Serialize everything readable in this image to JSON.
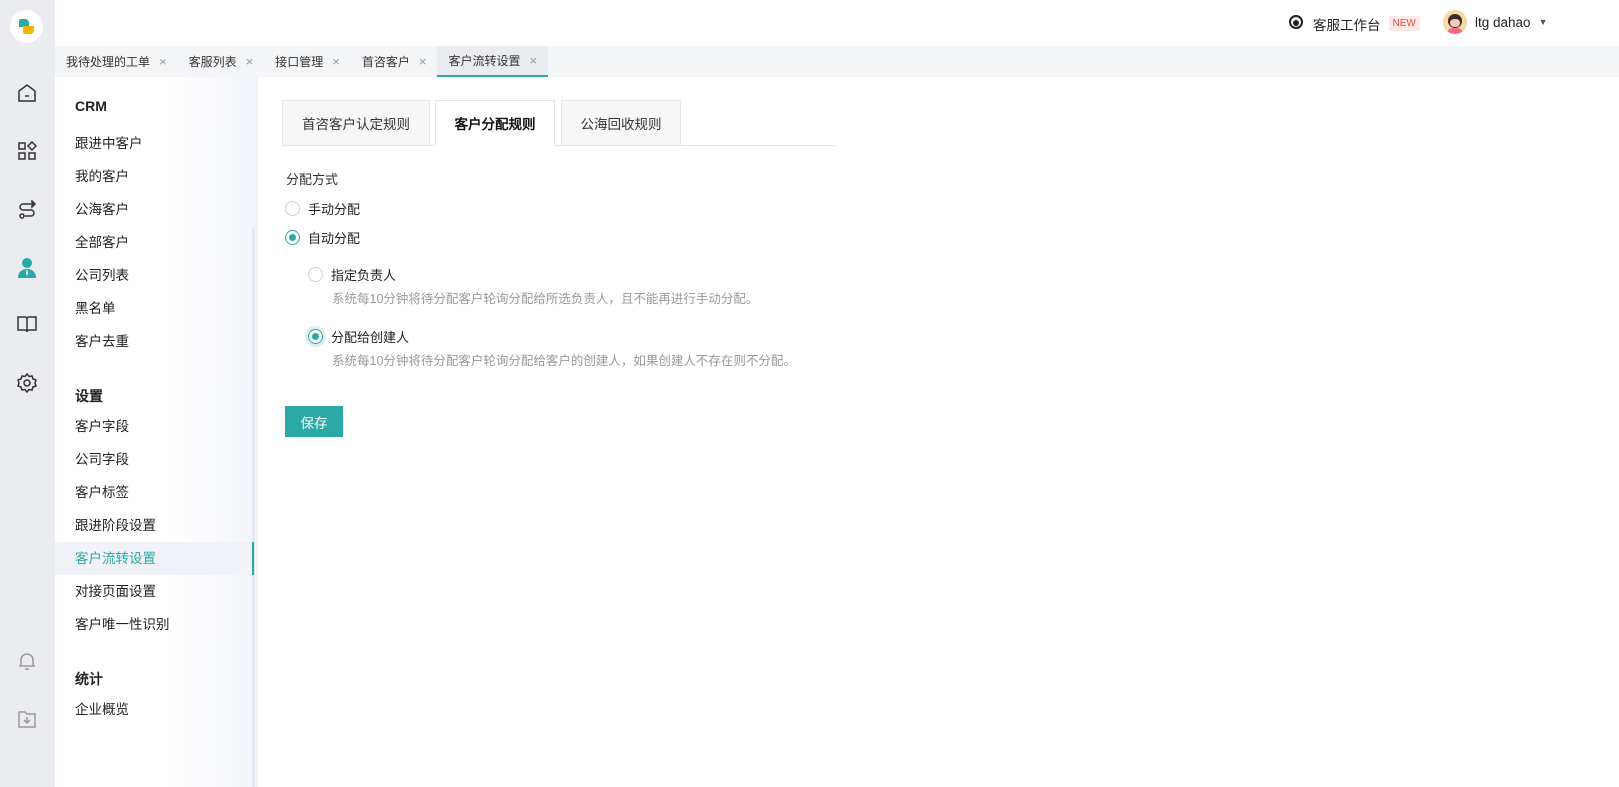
{
  "topbar": {
    "workbench": "客服工作台",
    "badge": "NEW",
    "user": "ltg dahao"
  },
  "tabs": [
    {
      "label": "我待处理的工单"
    },
    {
      "label": "客服列表"
    },
    {
      "label": "接口管理"
    },
    {
      "label": "首咨客户"
    },
    {
      "label": "客户流转设置"
    }
  ],
  "tab_close": "×",
  "sidebar": {
    "sections": [
      {
        "title": "CRM",
        "items": [
          "跟进中客户",
          "我的客户",
          "公海客户",
          "全部客户",
          "公司列表",
          "黑名单",
          "客户去重"
        ]
      },
      {
        "title": "设置",
        "items": [
          "客户字段",
          "公司字段",
          "客户标签",
          "跟进阶段设置",
          "客户流转设置",
          "对接页面设置",
          "客户唯一性识别"
        ]
      },
      {
        "title": "统计",
        "items": [
          "企业概览"
        ]
      }
    ],
    "active": "客户流转设置"
  },
  "content": {
    "tabs": [
      "首咨客户认定规则",
      "客户分配规则",
      "公海回收规则"
    ],
    "active_tab": "客户分配规则",
    "label": "分配方式",
    "modes": [
      "手动分配",
      "自动分配"
    ],
    "selected_mode": "自动分配",
    "sub_options": [
      {
        "label": "指定负责人",
        "desc": "系统每10分钟将待分配客户轮询分配给所选负责人，且不能再进行手动分配。"
      },
      {
        "label": "分配给创建人",
        "desc": "系统每10分钟将待分配客户轮询分配给客户的创建人，如果创建人不存在则不分配。"
      }
    ],
    "selected_sub": "分配给创建人",
    "save": "保存"
  },
  "colors": {
    "accent": "#2aa9a7",
    "badge_bg": "#fde8e8",
    "badge_text": "#f04848"
  }
}
